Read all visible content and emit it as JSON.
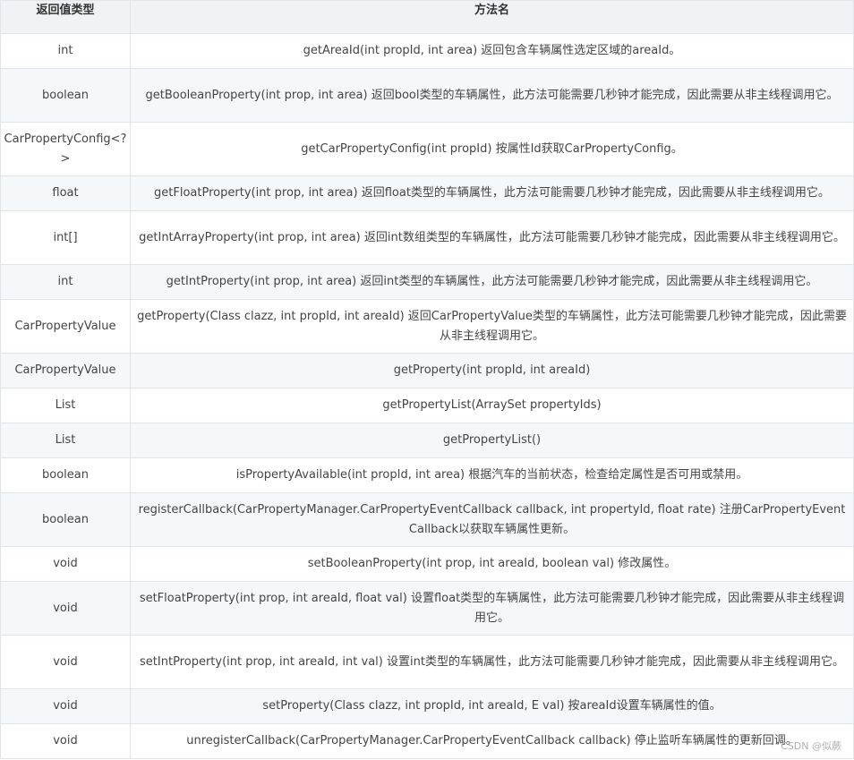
{
  "table": {
    "headers": [
      "返回值类型",
      "方法名"
    ],
    "rows": [
      {
        "type": "int",
        "method": "getAreaId(int propId, int area) 返回包含车辆属性选定区域的areaId。"
      },
      {
        "type": "boolean",
        "method": "getBooleanProperty(int prop, int area) 返回bool类型的车辆属性，此方法可能需要几秒钟才能完成，因此需要从非主线程调用它。"
      },
      {
        "type": "CarPropertyConfig<?>",
        "method": "getCarPropertyConfig(int propId) 按属性Id获取CarPropertyConfig。"
      },
      {
        "type": "float",
        "method": "getFloatProperty(int prop, int area) 返回float类型的车辆属性，此方法可能需要几秒钟才能完成，因此需要从非主线程调用它。"
      },
      {
        "type": "int[]",
        "method": "getIntArrayProperty(int prop, int area) 返回int数组类型的车辆属性，此方法可能需要几秒钟才能完成，因此需要从非主线程调用它。"
      },
      {
        "type": "int",
        "method": "getIntProperty(int prop, int area) 返回int类型的车辆属性，此方法可能需要几秒钟才能完成，因此需要从非主线程调用它。"
      },
      {
        "type": "CarPropertyValue",
        "method": "getProperty(Class clazz, int propId, int areaId) 返回CarPropertyValue类型的车辆属性，此方法可能需要几秒钟才能完成，因此需要从非主线程调用它。"
      },
      {
        "type": "CarPropertyValue",
        "method": "getProperty(int propId, int areaId)"
      },
      {
        "type": "List",
        "method": "getPropertyList(ArraySet propertyIds)"
      },
      {
        "type": "List",
        "method": "getPropertyList()"
      },
      {
        "type": "boolean",
        "method": "isPropertyAvailable(int propId, int area) 根据汽车的当前状态，检查给定属性是否可用或禁用。"
      },
      {
        "type": "boolean",
        "method": "registerCallback(CarPropertyManager.CarPropertyEventCallback callback, int propertyId, float rate) 注册CarPropertyEventCallback以获取车辆属性更新。"
      },
      {
        "type": "void",
        "method": "setBooleanProperty(int prop, int areaId, boolean val) 修改属性。"
      },
      {
        "type": "void",
        "method": "setFloatProperty(int prop, int areaId, float val) 设置float类型的车辆属性，此方法可能需要几秒钟才能完成，因此需要从非主线程调用它。"
      },
      {
        "type": "void",
        "method": "setIntProperty(int prop, int areaId, int val) 设置int类型的车辆属性，此方法可能需要几秒钟才能完成，因此需要从非主线程调用它。"
      },
      {
        "type": "void",
        "method": "setProperty(Class clazz, int propId, int areaId, E val) 按areaId设置车辆属性的值。"
      },
      {
        "type": "void",
        "method": "unregisterCallback(CarPropertyManager.CarPropertyEventCallback callback) 停止监听车辆属性的更新回调。"
      }
    ]
  },
  "watermark": "CSDN @似蕨"
}
